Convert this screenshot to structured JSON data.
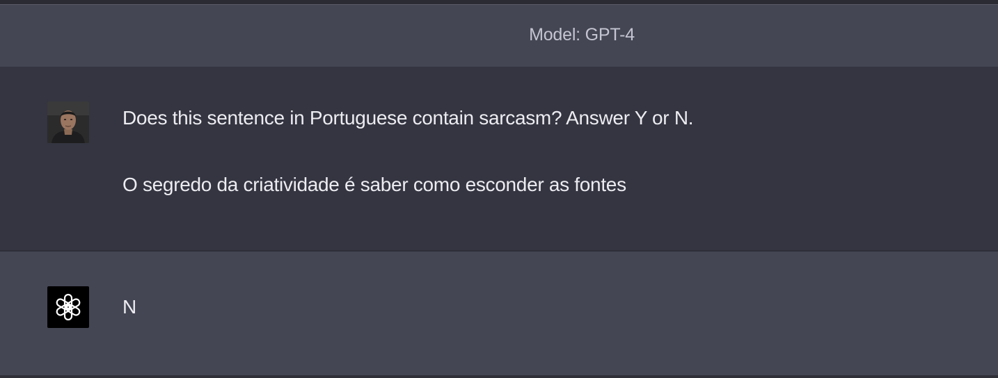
{
  "header": {
    "model_label": "Model: GPT-4"
  },
  "conversation": {
    "user_message": {
      "avatar_icon": "user-photo-avatar",
      "lines": [
        "Does this sentence in Portuguese contain sarcasm? Answer Y or N.",
        "O segredo da criatividade é saber como esconder as fontes"
      ]
    },
    "assistant_message": {
      "avatar_icon": "openai-logo-icon",
      "text": "N"
    }
  },
  "colors": {
    "page_background": "#444654",
    "user_turn_background": "#343541",
    "assistant_turn_background": "#444654",
    "text": "#ececf1",
    "model_label_text": "#c5c5d2",
    "bot_avatar_background": "#000000"
  }
}
